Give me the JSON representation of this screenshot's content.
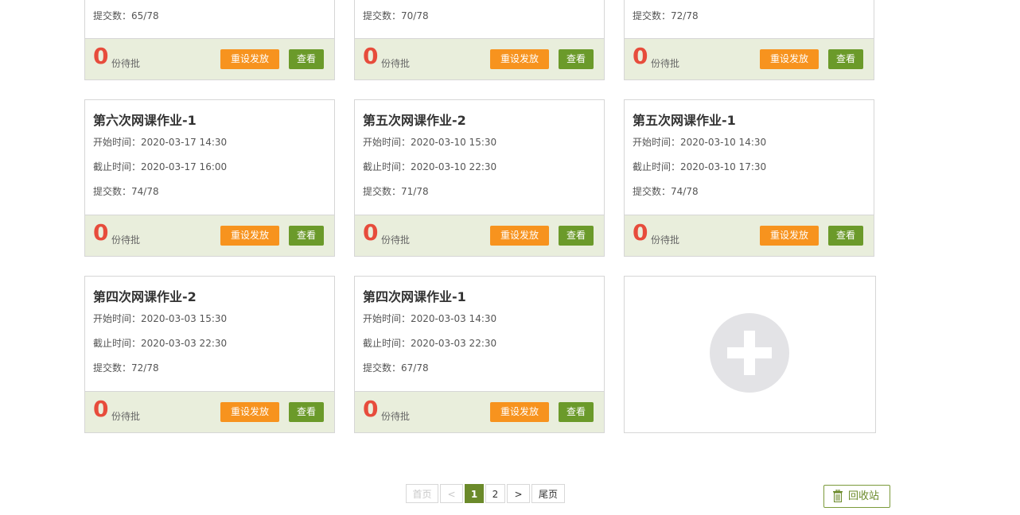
{
  "cards": [
    {
      "title": "",
      "start": "",
      "end": "",
      "submit": "提交数：65/78",
      "pending_count": "0",
      "pending_label": "份待批",
      "reset_label": "重设发放",
      "view_label": "查看"
    },
    {
      "title": "",
      "start": "",
      "end": "",
      "submit": "提交数：70/78",
      "pending_count": "0",
      "pending_label": "份待批",
      "reset_label": "重设发放",
      "view_label": "查看"
    },
    {
      "title": "",
      "start": "",
      "end": "",
      "submit": "提交数：72/78",
      "pending_count": "0",
      "pending_label": "份待批",
      "reset_label": "重设发放",
      "view_label": "查看"
    },
    {
      "title": "第六次网课作业-1",
      "start": "开始时间：2020-03-17 14:30",
      "end": "截止时间：2020-03-17 16:00",
      "submit": "提交数：74/78",
      "pending_count": "0",
      "pending_label": "份待批",
      "reset_label": "重设发放",
      "view_label": "查看"
    },
    {
      "title": "第五次网课作业-2",
      "start": "开始时间：2020-03-10 15:30",
      "end": "截止时间：2020-03-10 22:30",
      "submit": "提交数：71/78",
      "pending_count": "0",
      "pending_label": "份待批",
      "reset_label": "重设发放",
      "view_label": "查看"
    },
    {
      "title": "第五次网课作业-1",
      "start": "开始时间：2020-03-10 14:30",
      "end": "截止时间：2020-03-10 17:30",
      "submit": "提交数：74/78",
      "pending_count": "0",
      "pending_label": "份待批",
      "reset_label": "重设发放",
      "view_label": "查看"
    },
    {
      "title": "第四次网课作业-2",
      "start": "开始时间：2020-03-03 15:30",
      "end": "截止时间：2020-03-03 22:30",
      "submit": "提交数：72/78",
      "pending_count": "0",
      "pending_label": "份待批",
      "reset_label": "重设发放",
      "view_label": "查看"
    },
    {
      "title": "第四次网课作业-1",
      "start": "开始时间：2020-03-03 14:30",
      "end": "截止时间：2020-03-03 22:30",
      "submit": "提交数：67/78",
      "pending_count": "0",
      "pending_label": "份待批",
      "reset_label": "重设发放",
      "view_label": "查看"
    }
  ],
  "add_card": {
    "icon": "plus-icon"
  },
  "pagination": {
    "first": "首页",
    "prev": "<",
    "pages": [
      "1",
      "2"
    ],
    "current": "1",
    "next": ">",
    "last": "尾页"
  },
  "recycle": {
    "label": "回收站",
    "icon": "trash-icon"
  },
  "colors": {
    "count_red": "#e74c3c",
    "reset_orange": "#f7931e",
    "view_green": "#6b9a2a",
    "footer_bg": "#e9eedc",
    "active_page": "#6b8a2a"
  }
}
